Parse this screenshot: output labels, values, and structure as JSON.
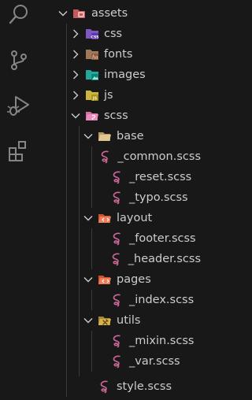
{
  "activity_bar": {
    "icons": [
      "search-icon",
      "source-control-icon",
      "run-debug-icon",
      "extensions-icon"
    ]
  },
  "colors": {
    "background": "#181818",
    "text": "#cccccc",
    "icon": "#858585",
    "sass_pink": "#cd6799"
  },
  "tree": {
    "items": [
      {
        "label": "assets",
        "icon": "folder-assets-open-icon",
        "expanded": true
      },
      {
        "label": "css",
        "icon": "folder-css-icon",
        "expanded": false
      },
      {
        "label": "fonts",
        "icon": "folder-fonts-icon",
        "expanded": false
      },
      {
        "label": "images",
        "icon": "folder-images-icon",
        "expanded": false
      },
      {
        "label": "js",
        "icon": "folder-js-icon",
        "expanded": false
      },
      {
        "label": "scss",
        "icon": "folder-sass-open-icon",
        "expanded": true
      },
      {
        "label": "base",
        "icon": "folder-base-open-icon",
        "expanded": true
      },
      {
        "label": "_common.scss",
        "icon": "sass-file-icon"
      },
      {
        "label": "_reset.scss",
        "icon": "sass-file-icon"
      },
      {
        "label": "_typo.scss",
        "icon": "sass-file-icon"
      },
      {
        "label": "layout",
        "icon": "folder-layout-open-icon",
        "expanded": true
      },
      {
        "label": "_footer.scss",
        "icon": "sass-file-icon"
      },
      {
        "label": "_header.scss",
        "icon": "sass-file-icon"
      },
      {
        "label": "pages",
        "icon": "folder-pages-open-icon",
        "expanded": true
      },
      {
        "label": "_index.scss",
        "icon": "sass-file-icon"
      },
      {
        "label": "utils",
        "icon": "folder-utils-open-icon",
        "expanded": true
      },
      {
        "label": "_mixin.scss",
        "icon": "sass-file-icon"
      },
      {
        "label": "_var.scss",
        "icon": "sass-file-icon"
      },
      {
        "label": "style.scss",
        "icon": "sass-file-icon"
      }
    ]
  }
}
